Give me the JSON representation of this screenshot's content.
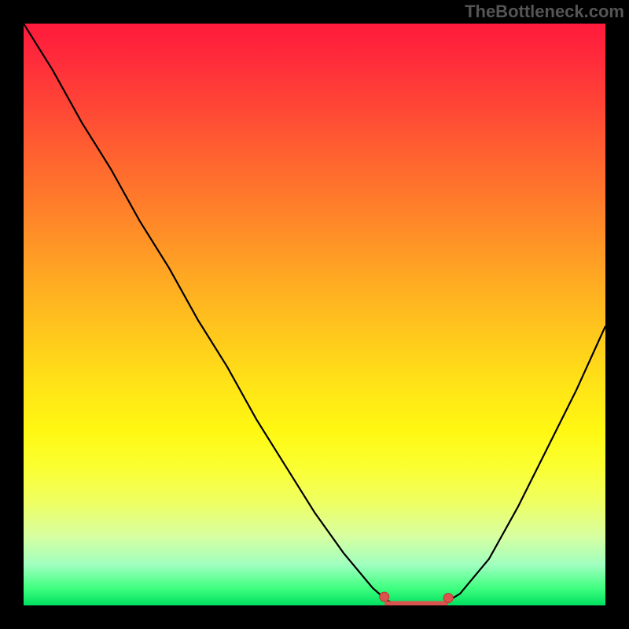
{
  "watermark": "TheBottleneck.com",
  "colors": {
    "gradient_top": "#ff1a3c",
    "gradient_bottom": "#00e060",
    "curve": "#000000",
    "marker": "#d9534f",
    "background": "#000000"
  },
  "chart_data": {
    "type": "line",
    "title": "",
    "xlabel": "",
    "ylabel": "",
    "note": "Background is a vertical color gradient (red→green).",
    "series": [
      {
        "name": "bottleneck-curve",
        "x": [
          0.0,
          0.05,
          0.1,
          0.15,
          0.2,
          0.25,
          0.3,
          0.35,
          0.4,
          0.45,
          0.5,
          0.55,
          0.6,
          0.625,
          0.65,
          0.675,
          0.7,
          0.725,
          0.75,
          0.8,
          0.85,
          0.9,
          0.95,
          1.0
        ],
        "y": [
          1.0,
          0.92,
          0.83,
          0.75,
          0.66,
          0.58,
          0.49,
          0.41,
          0.32,
          0.24,
          0.16,
          0.09,
          0.03,
          0.008,
          0.0,
          0.0,
          0.0,
          0.005,
          0.02,
          0.08,
          0.17,
          0.27,
          0.37,
          0.48
        ]
      }
    ],
    "markers": [
      {
        "x": 0.62,
        "y": 0.012
      },
      {
        "x": 0.73,
        "y": 0.01
      }
    ],
    "flat_segment": {
      "x0": 0.625,
      "x1": 0.725,
      "y": 0.0
    },
    "xlim": [
      0,
      1
    ],
    "ylim": [
      0,
      1
    ]
  }
}
